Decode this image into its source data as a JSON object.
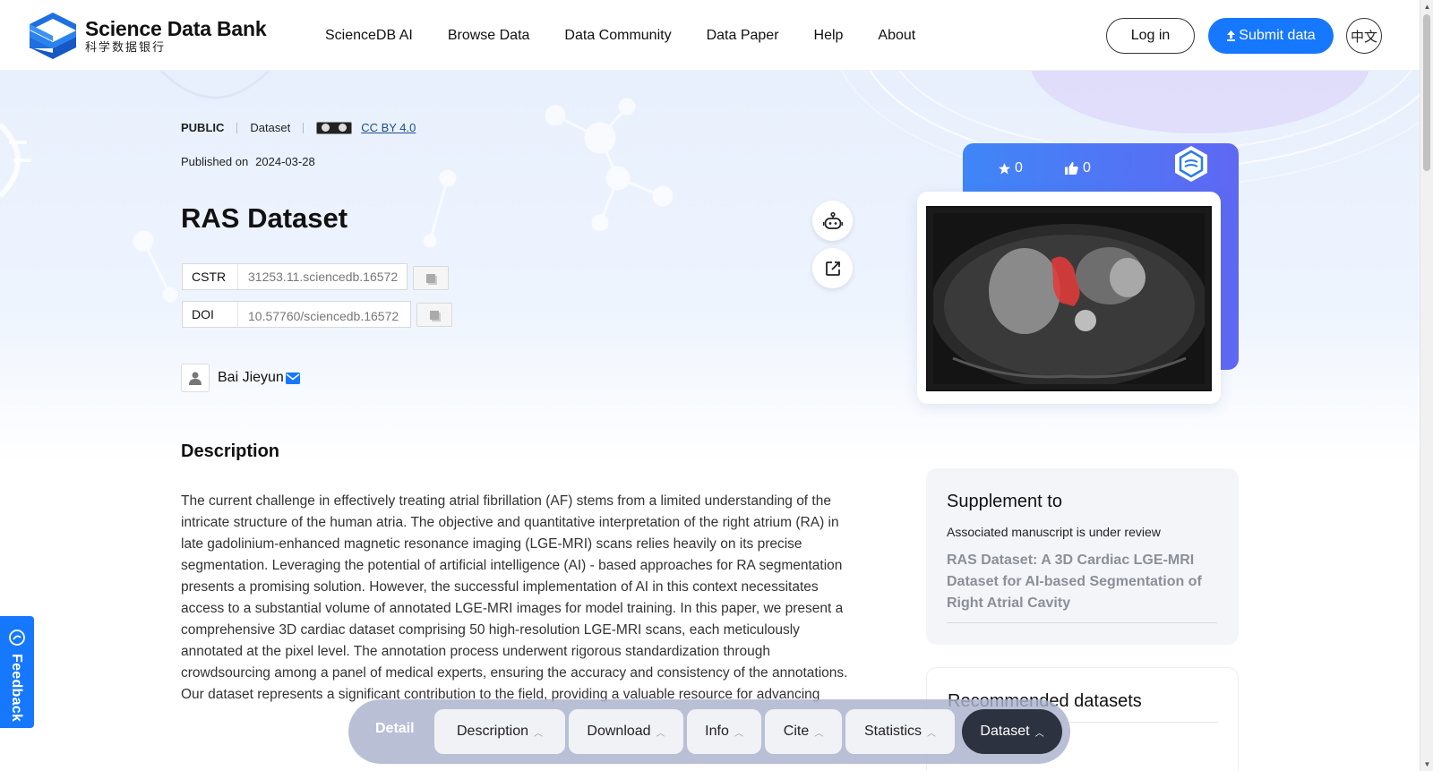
{
  "header": {
    "logo": {
      "title": "Science Data Bank",
      "subtitle": "科学数据银行"
    },
    "nav": [
      "ScienceDB AI",
      "Browse Data",
      "Data Community",
      "Data Paper",
      "Help",
      "About"
    ],
    "login_label": "Log in",
    "submit_label": "Submit data",
    "lang_label": "中文"
  },
  "dataset": {
    "access": "PUBLIC",
    "type": "Dataset",
    "license": "CC BY 4.0",
    "published_label": "Published on",
    "published_date": "2024-03-28",
    "title": "RAS Dataset",
    "cstr_key": "CSTR",
    "cstr_value": "31253.11.sciencedb.16572",
    "doi_key": "DOI",
    "doi_value": "10.57760/sciencedb.16572",
    "author": "Bai Jieyun"
  },
  "stats": {
    "stars": "0",
    "likes": "0"
  },
  "description": {
    "heading": "Description",
    "text": "The current challenge in effectively treating atrial fibrillation (AF) stems from a limited understanding of the intricate structure of the human atria. The objective and quantitative interpretation of the right atrium (RA) in late gadolinium-enhanced magnetic resonance imaging (LGE-MRI) scans relies heavily on its precise segmentation. Leveraging the potential of artificial intelligence (AI) - based approaches for RA segmentation presents a promising solution. However, the successful implementation of AI in this context necessitates access to a substantial volume of annotated LGE-MRI images for model training. In this paper, we present a comprehensive 3D cardiac dataset comprising 50 high-resolution LGE-MRI scans, each meticulously annotated at the pixel level. The annotation process underwent rigorous standardization through crowdsourcing among a panel of medical experts, ensuring the accuracy and consistency of the annotations. Our dataset represents a significant contribution to the field, providing a valuable resource for advancing"
  },
  "supplement": {
    "heading": "Supplement to",
    "note": "Associated manuscript is under review",
    "link": "RAS Dataset: A 3D Cardiac LGE-MRI Dataset for AI-based Segmentation of Right Atrial Cavity"
  },
  "recommended": {
    "heading": "Recommended datasets"
  },
  "feedback_label": "Feedback",
  "tabbar": {
    "detail": "Detail",
    "tabs": [
      "Description",
      "Download",
      "Info",
      "Cite",
      "Statistics",
      "Dataset"
    ]
  },
  "colors": {
    "accent": "#1677ff",
    "active_tab": "#2d3240"
  }
}
